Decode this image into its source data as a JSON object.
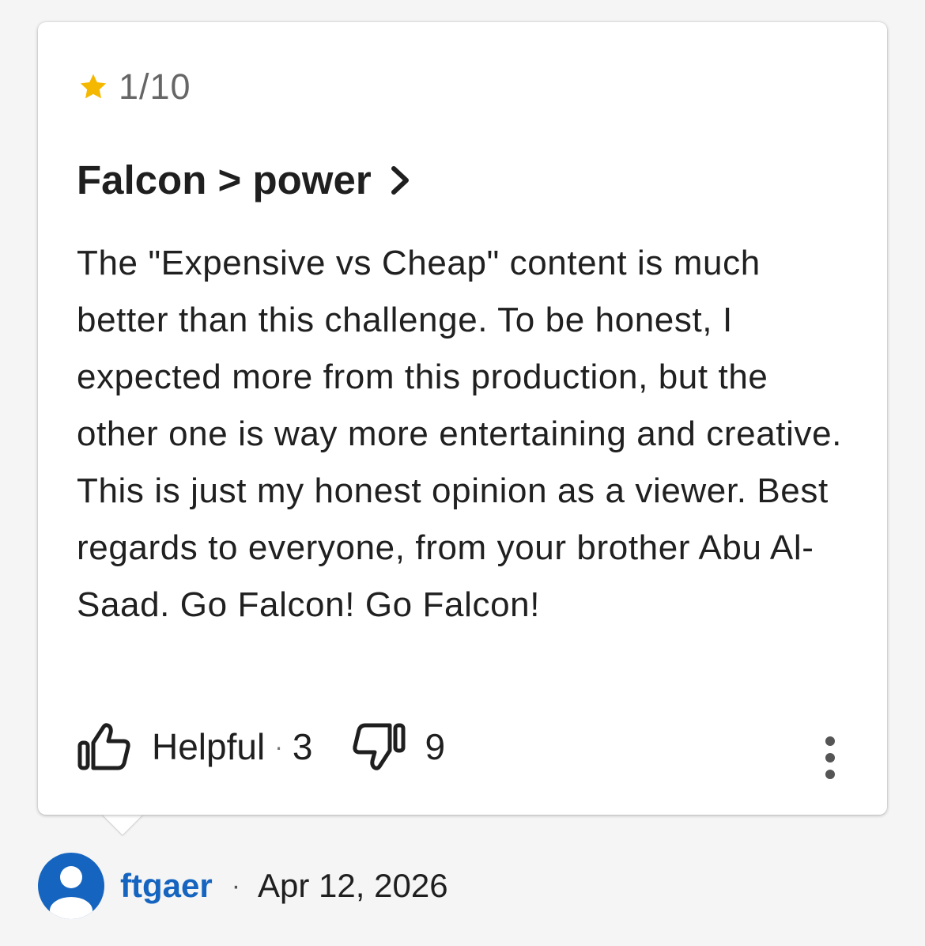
{
  "review": {
    "rating": "1/10",
    "rating_icon": "star-icon",
    "star_color": "#f5b800",
    "title": "Falcon > power",
    "body": "The \"Expensive vs Cheap\" content is much better than this challenge. To be honest, I expected more from this production, but the other one is way more entertaining and creative. This is just my honest opinion as a viewer. Best regards to everyone, from your brother Abu Al-Saad. Go Falcon! Go Falcon!",
    "actions": {
      "helpful_label": "Helpful",
      "separator": "·",
      "helpful_count": "3",
      "unhelpful_count": "9"
    }
  },
  "author": {
    "username": "ftgaer",
    "separator": "·",
    "date": "Apr 12, 2026",
    "avatar_color": "#1565c0",
    "username_color": "#1565c0"
  }
}
